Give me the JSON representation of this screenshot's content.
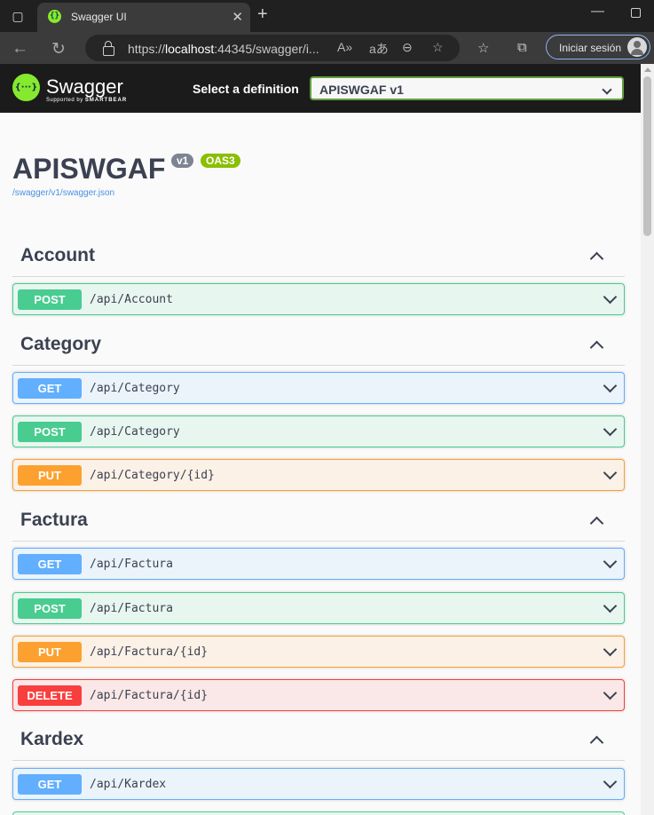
{
  "browser": {
    "tab_title": "Swagger UI",
    "tab_close": "✕",
    "new_tab": "+",
    "url_prefix": "https://",
    "url_host": "localhost",
    "url_rest": ":44345/swagger/i...",
    "signin_label": "Iniciar sesión"
  },
  "swagger": {
    "brand": "Swagger",
    "supported_by": "Supported by",
    "smartbear": "SMARTBEAR",
    "definition_label": "Select a definition",
    "definition_value": "APISWGAF v1",
    "api_title": "APISWGAF",
    "version_badge": "v1",
    "oas_badge": "OAS3",
    "spec_link": "/swagger/v1/swagger.json"
  },
  "tags": [
    {
      "name": "Account"
    },
    {
      "name": "Category"
    },
    {
      "name": "Factura"
    },
    {
      "name": "Kardex"
    }
  ],
  "operations": [
    {
      "method": "POST",
      "path": "/api/Account"
    },
    {
      "method": "GET",
      "path": "/api/Category"
    },
    {
      "method": "POST",
      "path": "/api/Category"
    },
    {
      "method": "PUT",
      "path": "/api/Category/{id}"
    },
    {
      "method": "GET",
      "path": "/api/Factura"
    },
    {
      "method": "POST",
      "path": "/api/Factura"
    },
    {
      "method": "PUT",
      "path": "/api/Factura/{id}"
    },
    {
      "method": "DELETE",
      "path": "/api/Factura/{id}"
    },
    {
      "method": "GET",
      "path": "/api/Kardex"
    }
  ],
  "colors": {
    "get": "#61affe",
    "post": "#49cc90",
    "put": "#fca130",
    "delete": "#f93e3e",
    "swagger_green": "#85ea2d"
  }
}
